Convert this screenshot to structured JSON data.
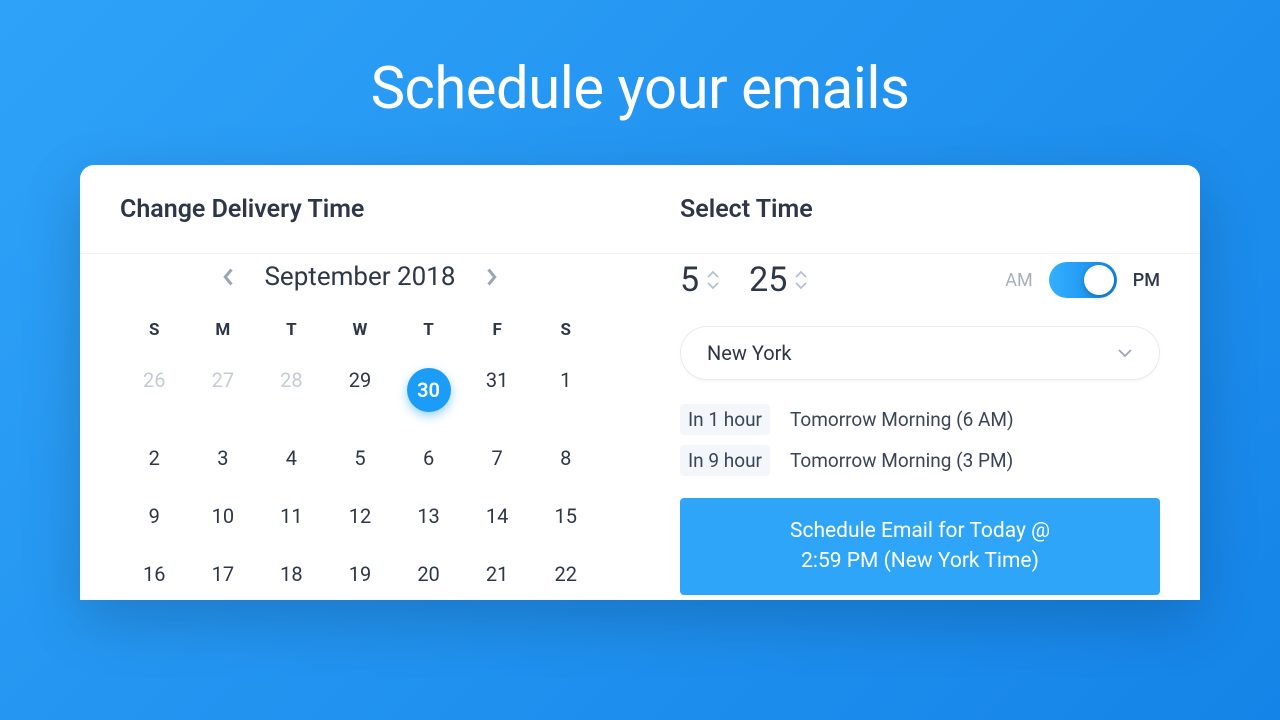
{
  "hero": {
    "title": "Schedule your emails"
  },
  "left": {
    "title": "Change Delivery Time",
    "month_label": "September 2018",
    "dow": [
      "S",
      "M",
      "T",
      "W",
      "T",
      "F",
      "S"
    ],
    "days": [
      {
        "n": "26",
        "dim": true
      },
      {
        "n": "27",
        "dim": true
      },
      {
        "n": "28",
        "dim": true
      },
      {
        "n": "29"
      },
      {
        "n": "30",
        "selected": true
      },
      {
        "n": "31"
      },
      {
        "n": "1"
      },
      {
        "n": "2"
      },
      {
        "n": "3"
      },
      {
        "n": "4"
      },
      {
        "n": "5"
      },
      {
        "n": "6"
      },
      {
        "n": "7"
      },
      {
        "n": "8"
      },
      {
        "n": "9"
      },
      {
        "n": "10"
      },
      {
        "n": "11"
      },
      {
        "n": "12"
      },
      {
        "n": "13"
      },
      {
        "n": "14"
      },
      {
        "n": "15"
      },
      {
        "n": "16"
      },
      {
        "n": "17"
      },
      {
        "n": "18"
      },
      {
        "n": "19"
      },
      {
        "n": "20"
      },
      {
        "n": "21"
      },
      {
        "n": "22"
      }
    ]
  },
  "right": {
    "title": "Select Time",
    "hour": "5",
    "minute": "25",
    "am_label": "AM",
    "pm_label": "PM",
    "ampm_value": "PM",
    "timezone": "New York",
    "quick": [
      {
        "left": "In 1 hour",
        "right": "Tomorrow Morning (6 AM)"
      },
      {
        "left": "In 9 hour",
        "right": "Tomorrow Morning (3 PM)"
      }
    ],
    "schedule_line1": "Schedule Email for Today @",
    "schedule_line2": "2:59 PM (New York Time)"
  }
}
